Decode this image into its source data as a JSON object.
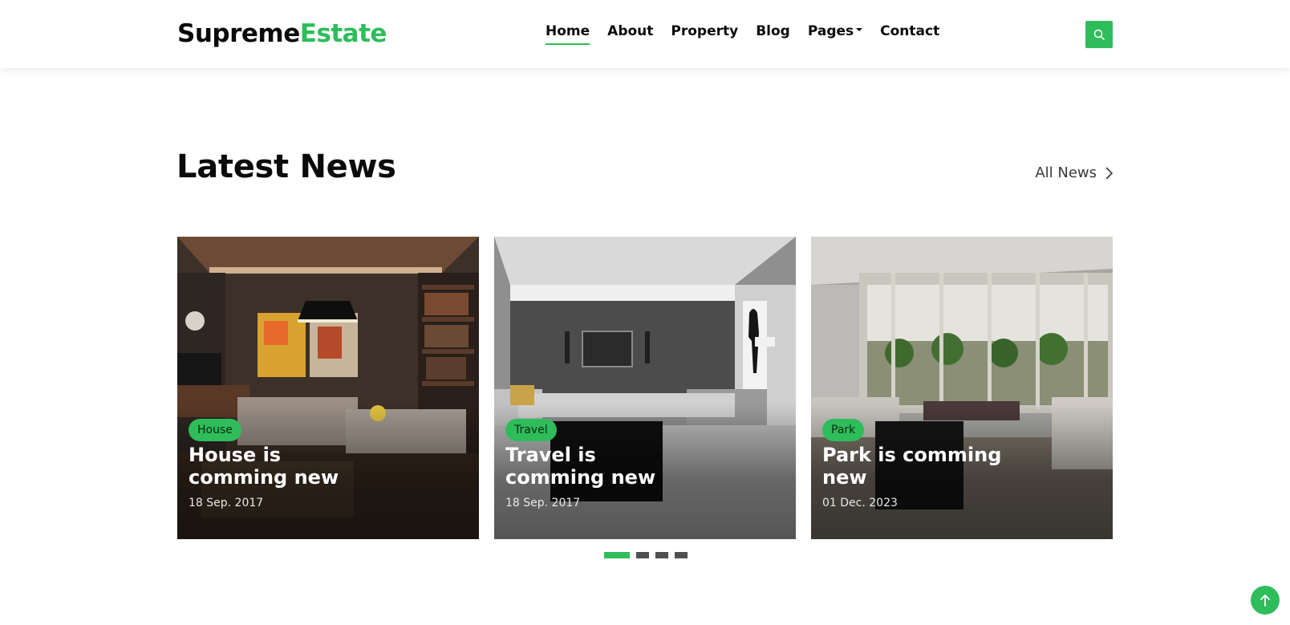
{
  "brand": {
    "part1": "Supreme",
    "part2": "Estate",
    "accent_color": "#2ebd5a"
  },
  "nav": {
    "items": [
      {
        "label": "Home",
        "active": true
      },
      {
        "label": "About"
      },
      {
        "label": "Property"
      },
      {
        "label": "Blog"
      },
      {
        "label": "Pages",
        "dropdown": true
      },
      {
        "label": "Contact"
      }
    ],
    "search_icon": "search-icon"
  },
  "news": {
    "title": "Latest News",
    "all_link": "All News",
    "cards": [
      {
        "tag": "House",
        "title": "House is comming new",
        "date": "18 Sep. 2017",
        "image": "living-room-dark-wood-photo"
      },
      {
        "tag": "Travel",
        "title": "Travel is comming new",
        "date": "18 Sep. 2017",
        "image": "living-room-grey-tv-wall-photo"
      },
      {
        "tag": "Park",
        "title": "Park is comming new",
        "date": "01 Dec. 2023",
        "image": "open-lounge-patio-photo"
      }
    ],
    "pager": {
      "pages": 4,
      "active": 1
    }
  },
  "back_to_top_icon": "arrow-up-icon"
}
